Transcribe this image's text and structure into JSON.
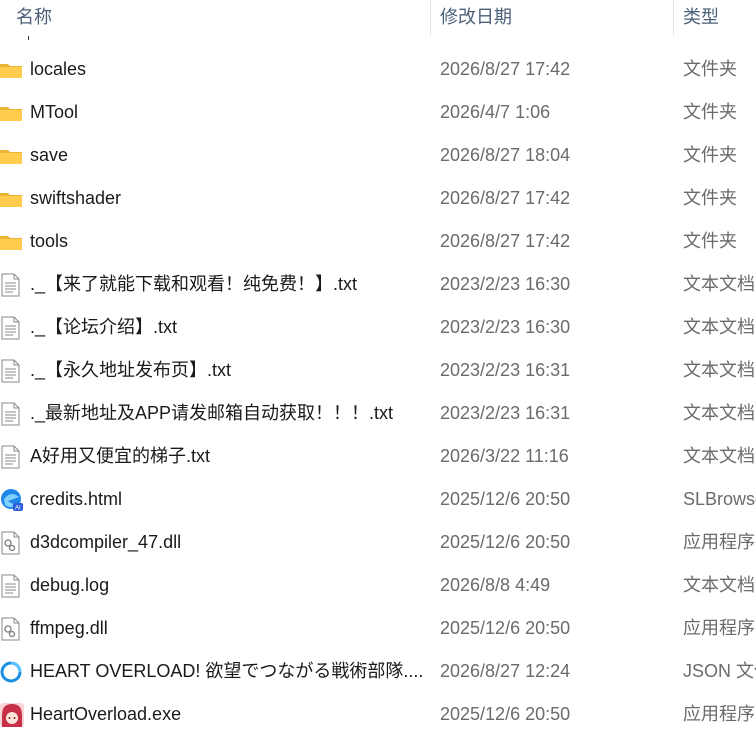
{
  "columns": {
    "name": "名称",
    "date": "修改日期",
    "type": "类型"
  },
  "files": [
    {
      "name": "locales",
      "date": "2026/8/27 17:42",
      "type": "文件夹",
      "icon": "folder-icon"
    },
    {
      "name": "MTool",
      "date": "2026/4/7 1:06",
      "type": "文件夹",
      "icon": "folder-icon"
    },
    {
      "name": "save",
      "date": "2026/8/27 18:04",
      "type": "文件夹",
      "icon": "folder-icon"
    },
    {
      "name": "swiftshader",
      "date": "2026/8/27 17:42",
      "type": "文件夹",
      "icon": "folder-icon"
    },
    {
      "name": "tools",
      "date": "2026/8/27 17:42",
      "type": "文件夹",
      "icon": "folder-icon"
    },
    {
      "name": "._【来了就能下载和观看！纯免费！】.txt",
      "date": "2023/2/23 16:30",
      "type": "文本文档",
      "icon": "text-file-icon"
    },
    {
      "name": "._【论坛介绍】.txt",
      "date": "2023/2/23 16:30",
      "type": "文本文档",
      "icon": "text-file-icon"
    },
    {
      "name": "._【永久地址发布页】.txt",
      "date": "2023/2/23 16:31",
      "type": "文本文档",
      "icon": "text-file-icon"
    },
    {
      "name": "._最新地址及APP请发邮箱自动获取！！！.txt",
      "date": "2023/2/23 16:31",
      "type": "文本文档",
      "icon": "text-file-icon"
    },
    {
      "name": "A好用又便宜的梯子.txt",
      "date": "2026/3/22 11:16",
      "type": "文本文档",
      "icon": "text-file-icon"
    },
    {
      "name": "credits.html",
      "date": "2025/12/6 20:50",
      "type": "SLBrowser",
      "icon": "browser-html-icon"
    },
    {
      "name": "d3dcompiler_47.dll",
      "date": "2025/12/6 20:50",
      "type": "应用程序扩展",
      "icon": "dll-file-icon"
    },
    {
      "name": "debug.log",
      "date": "2026/8/8 4:49",
      "type": "文本文档",
      "icon": "text-file-icon"
    },
    {
      "name": "ffmpeg.dll",
      "date": "2025/12/6 20:50",
      "type": "应用程序扩展",
      "icon": "dll-file-icon"
    },
    {
      "name": "HEART OVERLOAD! 欲望でつながる戦術部隊....",
      "date": "2026/8/27 12:24",
      "type": "JSON 文件",
      "icon": "json-file-icon"
    },
    {
      "name": "HeartOverload.exe",
      "date": "2025/12/6 20:50",
      "type": "应用程序",
      "icon": "app-exe-icon"
    }
  ]
}
